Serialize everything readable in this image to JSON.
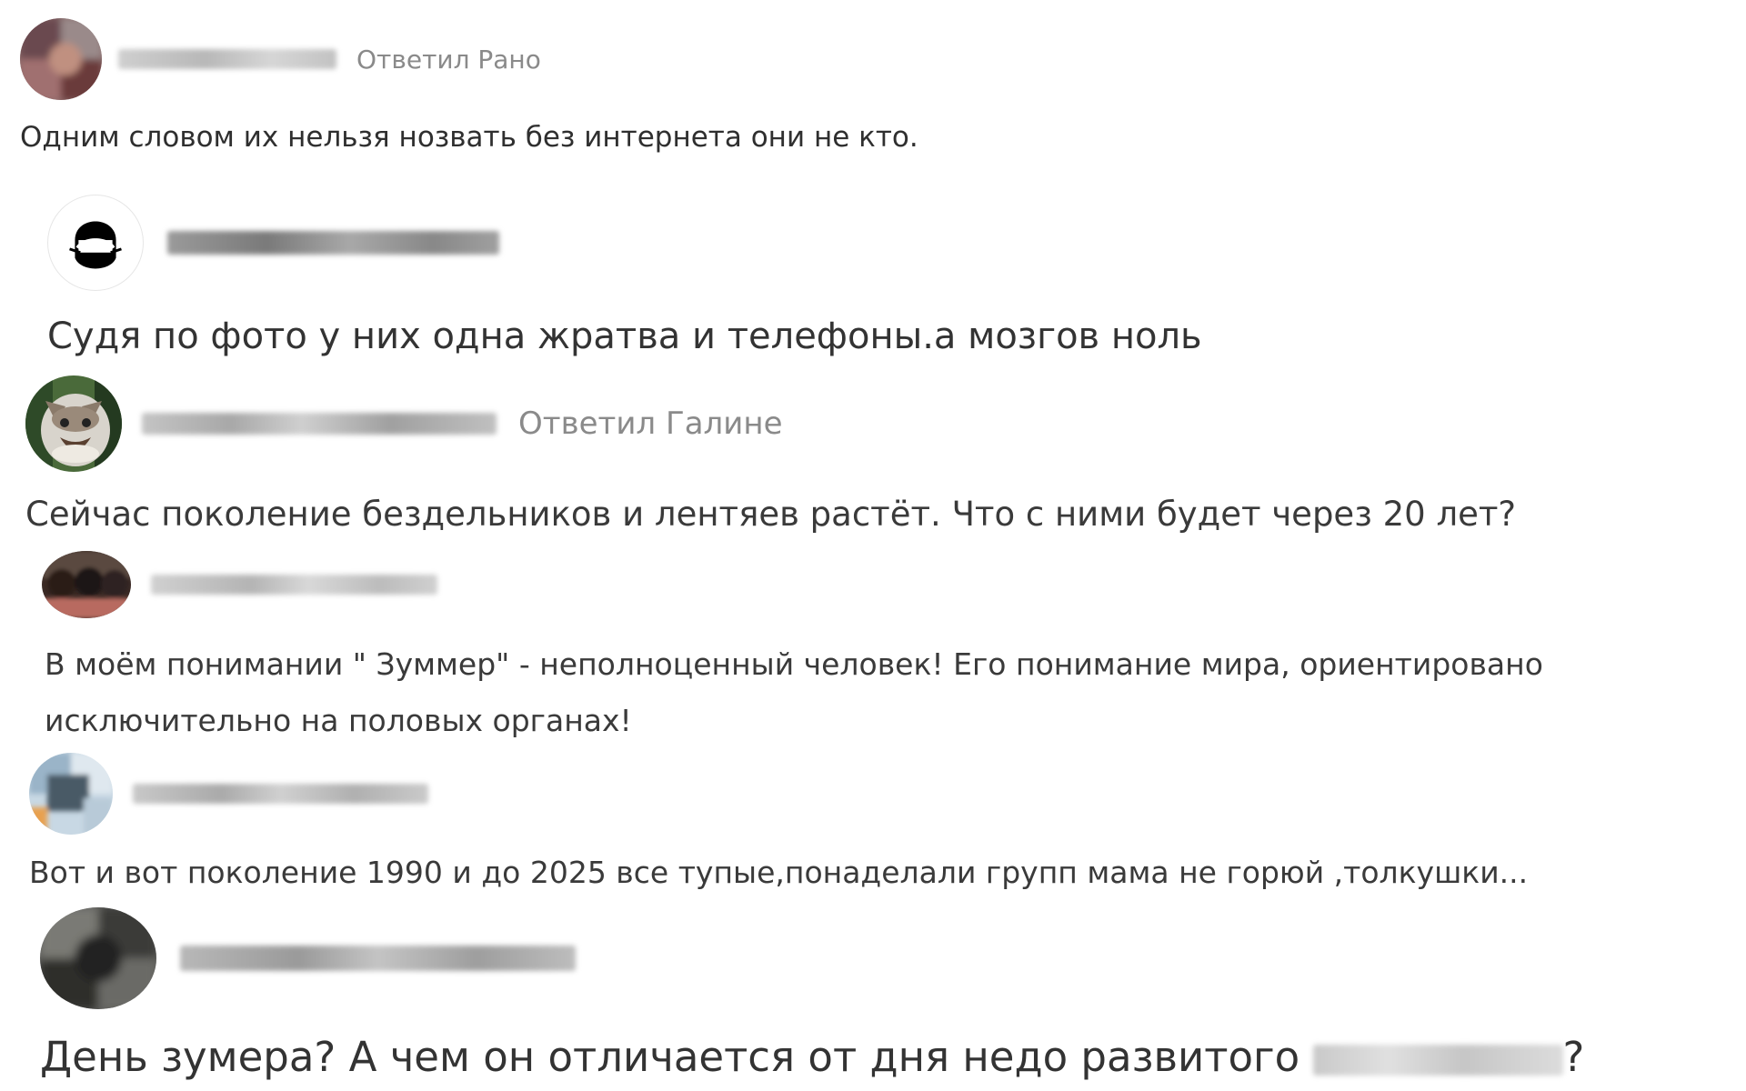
{
  "comments": [
    {
      "reply_to": "Ответил Рано",
      "text": "Одним словом их нельзя нозвать без интернета они не кто."
    },
    {
      "reply_to": "",
      "text": "Судя по фото у них одна жратва и телефоны.а мозгов ноль"
    },
    {
      "reply_to": "Ответил Галине",
      "text": "Сейчас поколение бездельников и лентяев растёт. Что с ними будет через 20 лет?"
    },
    {
      "reply_to": "",
      "text": "В моём понимании \" Зуммер\" - неполноценный человек! Его понимание мира, ориентировано исключительно на половых органах!"
    },
    {
      "reply_to": "",
      "text": "Вот и вот поколение 1990 и до 2025 все тупые,понаделали групп мама не горюй ,толкушки..."
    },
    {
      "reply_to": "",
      "text_before": "День зумера? А чем он отличается от дня недо развитого",
      "text_after": "?"
    }
  ],
  "avatars": [
    {
      "icon": "blurred-photo-avatar-icon",
      "color": "#7a5050"
    },
    {
      "icon": "masked-person-avatar-icon",
      "color": "#000000"
    },
    {
      "icon": "cat-photo-avatar-icon",
      "color": "#5a6a50"
    },
    {
      "icon": "group-photo-avatar-icon",
      "color": "#3a2a25"
    },
    {
      "icon": "blurred-photo-avatar-icon",
      "color": "#6a8aa0"
    },
    {
      "icon": "blurred-photo-avatar-icon",
      "color": "#4a4a48"
    }
  ]
}
